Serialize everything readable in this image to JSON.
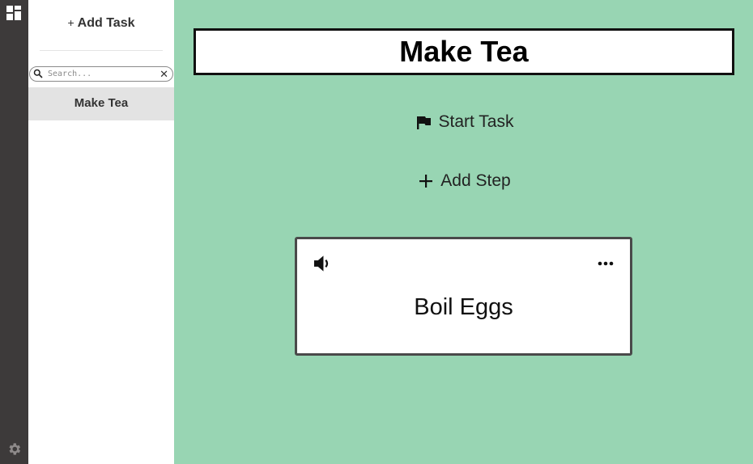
{
  "rail": {
    "top_icon": "dashboard-icon",
    "bottom_icon": "gear-icon"
  },
  "sidebar": {
    "add_task_label": "Add Task",
    "search_placeholder": "Search...",
    "search_value": "",
    "tasks": [
      {
        "label": "Make Tea",
        "selected": true
      }
    ]
  },
  "main": {
    "task_title": "Make Tea",
    "start_task_label": "Start Task",
    "add_step_label": "Add Step",
    "steps": [
      {
        "title": "Boil Eggs",
        "audio_icon": "speaker-icon",
        "menu_icon": "more-icon"
      }
    ]
  },
  "colors": {
    "background": "#98d5b3",
    "rail": "#3d3a3a",
    "sidebar": "#ffffff",
    "selected_task": "#e3e3e3"
  }
}
